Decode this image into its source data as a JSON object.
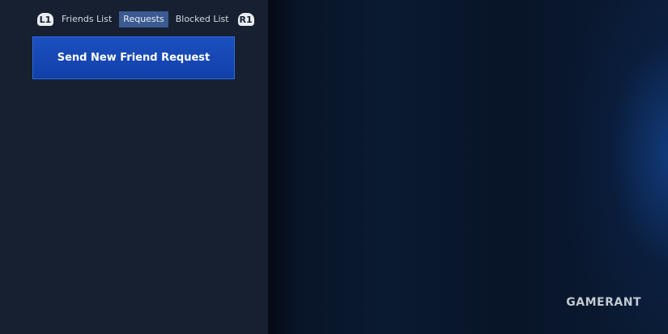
{
  "tabs": {
    "left_button_glyph": "L1",
    "right_button_glyph": "R1",
    "items": [
      {
        "label": "Friends List"
      },
      {
        "label": "Requests"
      },
      {
        "label": "Blocked List"
      }
    ],
    "active_index": 1
  },
  "actions": {
    "send_request_label": "Send New Friend Request"
  },
  "watermark": {
    "text": "GAMERANT"
  },
  "colors": {
    "left_panel_bg": "#162030",
    "active_tab_bg": "#3b5a91",
    "primary_button": "#1c4fc0"
  }
}
